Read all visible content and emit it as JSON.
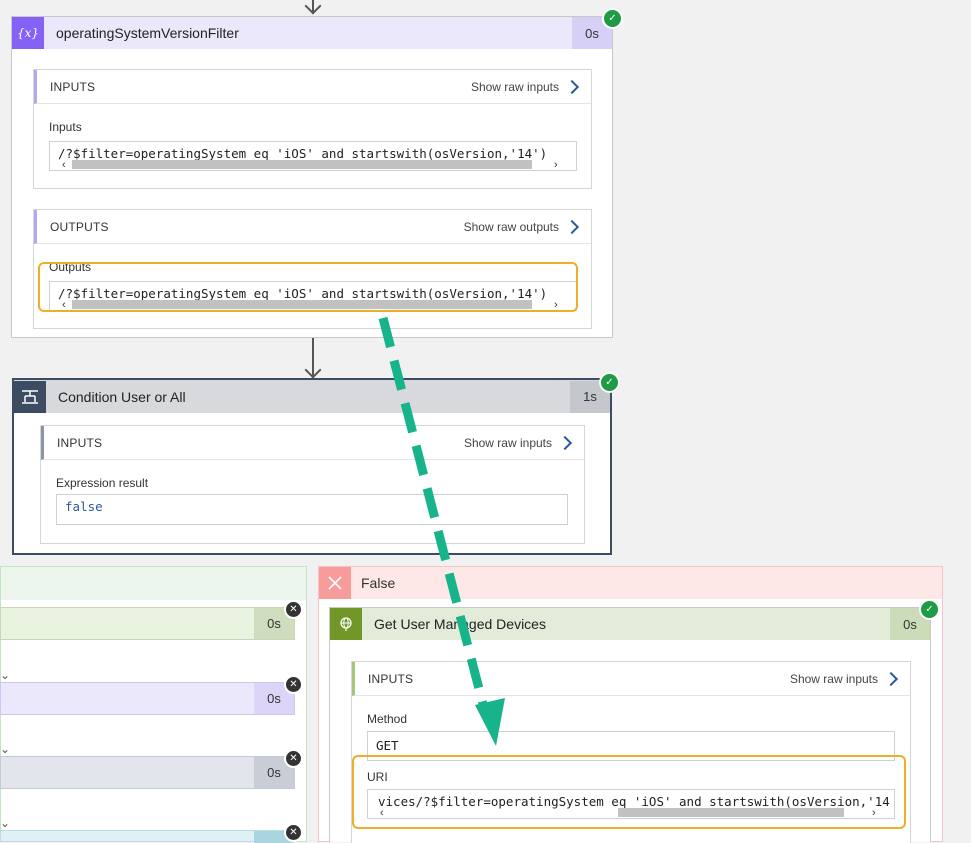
{
  "card1": {
    "title": "operatingSystemVersionFilter",
    "icon": "curly-braces-icon",
    "icon_glyph": "{𝑥}",
    "duration": "0s",
    "inputs": {
      "header": "INPUTS",
      "raw_link": "Show raw inputs",
      "field_label": "Inputs",
      "field_value": "/?$filter=operatingSystem eq 'iOS' and startswith(osVersion,'14')"
    },
    "outputs": {
      "header": "OUTPUTS",
      "raw_link": "Show raw outputs",
      "field_label": "Outputs",
      "field_value": "/?$filter=operatingSystem eq 'iOS' and startswith(osVersion,'14')"
    }
  },
  "card2": {
    "title": "Condition User or All",
    "icon": "condition-icon",
    "duration": "1s",
    "inputs": {
      "header": "INPUTS",
      "raw_link": "Show raw inputs",
      "field_label": "Expression result",
      "field_value": "false"
    }
  },
  "left_branch": {
    "durations": [
      "0s",
      "0s",
      "0s"
    ]
  },
  "false_branch": {
    "title": "False",
    "card": {
      "title": "Get User Managed Devices",
      "icon": "globe-icon",
      "duration": "0s",
      "inputs": {
        "header": "INPUTS",
        "raw_link": "Show raw inputs",
        "method_label": "Method",
        "method_value": "GET",
        "uri_label": "URI",
        "uri_value": "vices/?$filter=operatingSystem eq 'iOS' and startswith(osVersion,'14"
      }
    }
  },
  "colors": {
    "compose_accent": "#8661f5",
    "compose_header": "#ebe8fc",
    "condition_accent": "#3c4d63",
    "condition_header": "#d7d9dc",
    "http_accent": "#709727",
    "http_header": "#e2ecd8",
    "false_header": "#fde7e7",
    "success": "#1f9a45",
    "highlight": "#f0ad2a",
    "dashed_arrow": "#17b38a"
  }
}
